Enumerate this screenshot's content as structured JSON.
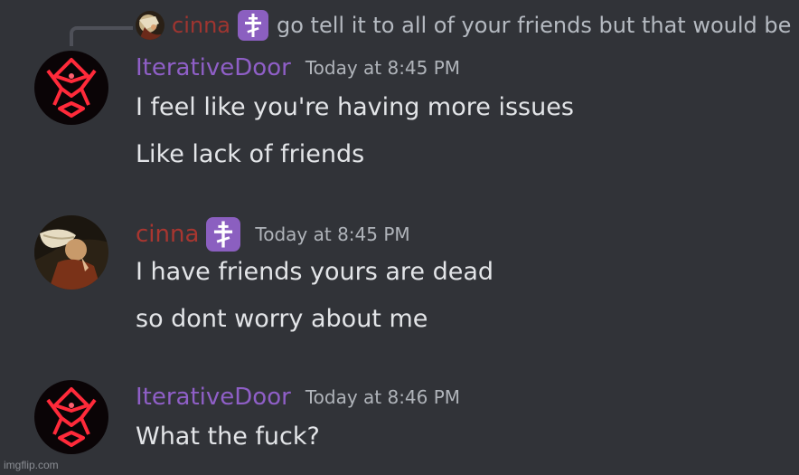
{
  "reply": {
    "author": "cinna",
    "text": "go tell it to all of your friends but that would be ..."
  },
  "messages": [
    {
      "author": "IterativeDoor",
      "timestamp": "Today at 8:45 PM",
      "lines": [
        "I feel like you're having more issues",
        "Like lack of friends"
      ]
    },
    {
      "author": "cinna",
      "timestamp": "Today at 8:45 PM",
      "lines": [
        "I have friends yours are dead",
        "so dont worry about me"
      ]
    },
    {
      "author": "IterativeDoor",
      "timestamp": "Today at 8:46 PM",
      "lines": [
        "What the fuck?"
      ]
    }
  ],
  "badge_icon": "orthodox-cross-icon",
  "watermark": "imgflip.com",
  "colors": {
    "background": "#313338",
    "iterative_name": "#8f5fc7",
    "cinna_name": "#a83630",
    "badge": "#8b5fc0",
    "text": "#e3e5e8",
    "timestamp": "#b0b4ba"
  }
}
